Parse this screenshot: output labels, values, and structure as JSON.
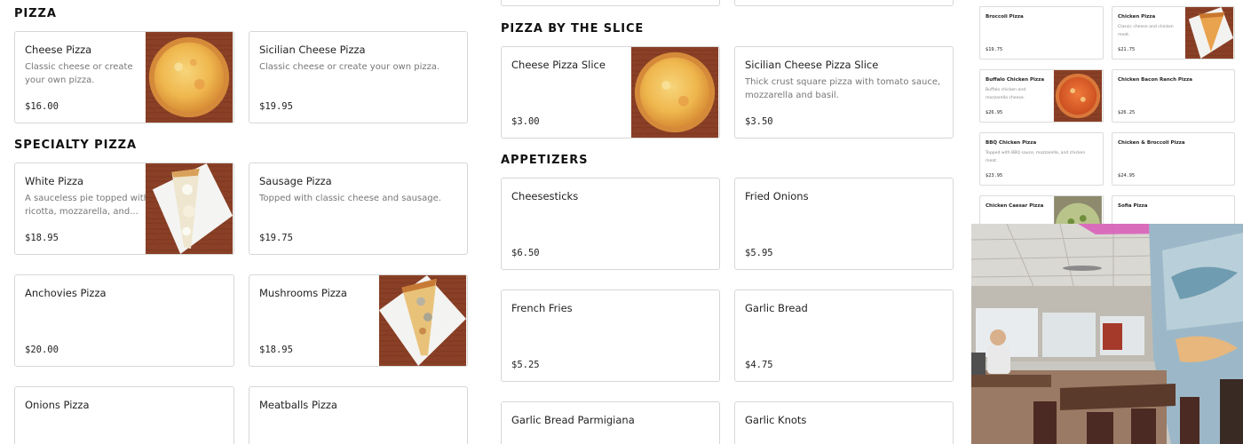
{
  "sections": {
    "pizza": "PIZZA",
    "specialty": "SPECIALTY PIZZA",
    "slice": "PIZZA BY THE SLICE",
    "appetizers": "APPETIZERS"
  },
  "pizza": [
    {
      "name": "Cheese Pizza",
      "desc1": "Classic cheese or create",
      "desc2": "your own pizza.",
      "price": "$16.00"
    },
    {
      "name": "Sicilian Cheese Pizza",
      "desc1": "Classic cheese or create your own pizza.",
      "price": "$19.95"
    }
  ],
  "specialty": [
    {
      "name": "White Pizza",
      "desc1": "A sauceless pie topped with",
      "desc2": "ricotta, mozzarella, and...",
      "price": "$18.95"
    },
    {
      "name": "Sausage Pizza",
      "desc1": "Topped with classic cheese and sausage.",
      "price": "$19.75"
    },
    {
      "name": "Anchovies Pizza",
      "price": "$20.00"
    },
    {
      "name": "Mushrooms Pizza",
      "price": "$18.95"
    },
    {
      "name": "Onions Pizza"
    },
    {
      "name": "Meatballs Pizza"
    }
  ],
  "slice": [
    {
      "name": "Cheese Pizza Slice",
      "price": "$3.00"
    },
    {
      "name": "Sicilian Cheese Pizza Slice",
      "desc1": "Thick crust square pizza with tomato sauce,",
      "desc2": "mozzarella and basil.",
      "price": "$3.50"
    }
  ],
  "appetizers": [
    {
      "name": "Cheesesticks",
      "price": "$6.50"
    },
    {
      "name": "Fried Onions",
      "price": "$5.95"
    },
    {
      "name": "French Fries",
      "price": "$5.25"
    },
    {
      "name": "Garlic Bread",
      "price": "$4.75"
    },
    {
      "name": "Garlic Bread Parmigiana"
    },
    {
      "name": "Garlic Knots"
    }
  ],
  "preview": [
    {
      "name": "Broccoli Pizza",
      "price": "$19.75"
    },
    {
      "name": "Chicken Pizza",
      "desc1": "Classic cheese and chicken",
      "desc2": "meat.",
      "price": "$21.75"
    },
    {
      "name": "Buffalo Chicken Pizza",
      "desc1": "Buffalo chicken and",
      "desc2": "mozzarella cheese.",
      "price": "$26.95"
    },
    {
      "name": "Chicken Bacon Ranch Pizza",
      "price": "$26.25"
    },
    {
      "name": "BBQ Chicken Pizza",
      "desc1": "Topped with BBQ sauce, mozzarella, and chicken",
      "desc2": "meat.",
      "price": "$23.95"
    },
    {
      "name": "Chicken & Broccoli Pizza",
      "price": "$24.95"
    },
    {
      "name": "Chicken Caesar Pizza"
    },
    {
      "name": "Sofia Pizza"
    }
  ],
  "colors": {
    "border": "#d7d7d7",
    "text": "#222222",
    "muted": "#777777",
    "tabletop": "#7a3a22"
  }
}
